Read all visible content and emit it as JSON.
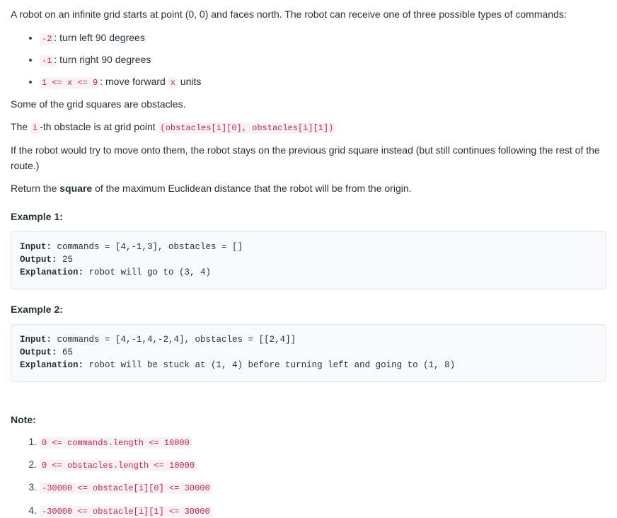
{
  "intro": {
    "paragraph": "A robot on an infinite grid starts at point (0, 0) and faces north.  The robot can receive one of three possible types of commands:"
  },
  "commands": [
    {
      "code": "-2",
      "text": ": turn left 90 degrees"
    },
    {
      "code": "-1",
      "text": ": turn right 90 degrees"
    },
    {
      "code": "1 <= x <= 9",
      "text": ": move forward ",
      "code2": "x",
      "text2": " units"
    }
  ],
  "body": {
    "obstacles_intro": "Some of the grid squares are obstacles.",
    "ith_prefix": "The ",
    "ith_code": "i",
    "ith_middle": "-th obstacle is at grid point ",
    "ith_code2": "(obstacles[i][0], obstacles[i][1])",
    "stuck_rule": "If the robot would try to move onto them, the robot stays on the previous grid square instead (but still continues following the rest of the route.)",
    "return_prefix": "Return the ",
    "return_strong": "square",
    "return_suffix": " of the maximum Euclidean distance that the robot will be from the origin."
  },
  "examples": [
    {
      "title": "Example 1:",
      "input_label": "Input:",
      "input_value": " commands = [4,-1,3], obstacles = []",
      "output_label": "Output:",
      "output_value": " 25",
      "explanation_label": "Explanation:",
      "explanation_value": " robot will go to (3, 4)"
    },
    {
      "title": "Example 2:",
      "input_label": "Input:",
      "input_value": " commands = [4,-1,4,-2,4], obstacles = [[2,4]]",
      "output_label": "Output:",
      "output_value": " 65",
      "explanation_label": "Explanation:",
      "explanation_value": " robot will be stuck at (1, 4) before turning left and going to (1, 8)"
    }
  ],
  "note": {
    "title": "Note:",
    "items": [
      "0 <= commands.length <= 10000",
      "0 <= obstacles.length <= 10000",
      "-30000 <= obstacle[i][0] <= 30000",
      "-30000 <= obstacle[i][1] <= 30000"
    ]
  },
  "colors": {
    "inline_code_text": "#c7254e",
    "inline_code_bg": "#f9f2f4",
    "codeblock_bg": "#f7f9fa",
    "codeblock_border": "#e3e6e8",
    "body_text": "#263238"
  }
}
